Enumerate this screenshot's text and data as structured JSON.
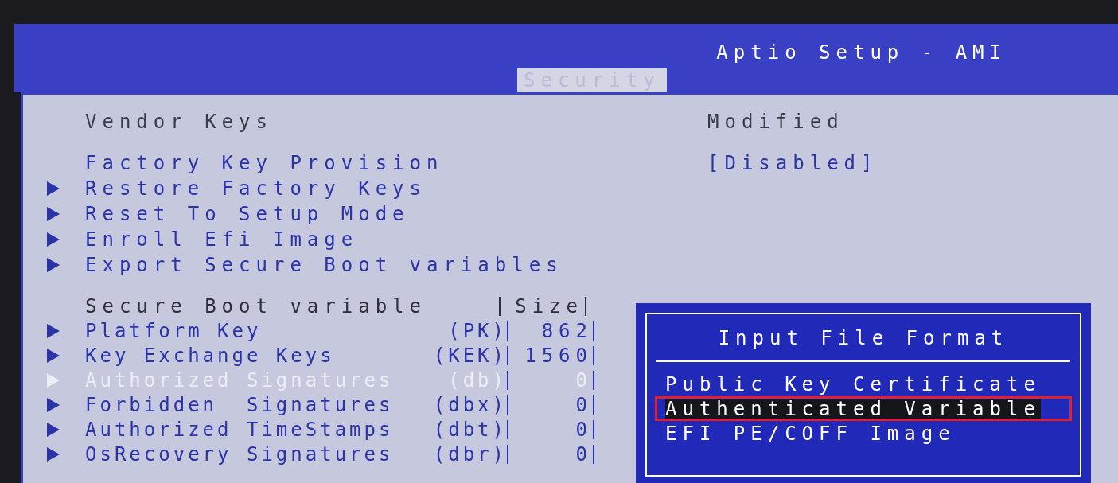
{
  "header": {
    "title": "Aptio Setup - AMI",
    "tabs": [
      {
        "label": "Security",
        "selected": true
      }
    ]
  },
  "sections": [
    {
      "items": [
        {
          "kind": "info",
          "label": "Vendor Keys",
          "value": "Modified"
        }
      ]
    },
    {
      "items": [
        {
          "kind": "option",
          "label": "Factory Key Provision",
          "value": "[Disabled]"
        },
        {
          "kind": "submenu",
          "label": "Restore Factory Keys"
        },
        {
          "kind": "submenu",
          "label": "Reset To Setup Mode"
        },
        {
          "kind": "submenu",
          "label": "Enroll Efi Image"
        },
        {
          "kind": "submenu",
          "label": "Export Secure Boot variables"
        }
      ]
    }
  ],
  "variables_table": {
    "columns": [
      "Secure Boot variable",
      "Size"
    ],
    "rows": [
      {
        "name": "Platform Key",
        "code": "(PK)",
        "size": "862",
        "disabled": false
      },
      {
        "name": "Key Exchange Keys",
        "code": "(KEK)",
        "size": "1560",
        "disabled": false
      },
      {
        "name": "Authorized Signatures",
        "code": "(db)",
        "size": "0",
        "disabled": true
      },
      {
        "name": "Forbidden  Signatures",
        "code": "(dbx)",
        "size": "0",
        "disabled": false
      },
      {
        "name": "Authorized TimeStamps",
        "code": "(dbt)",
        "size": "0",
        "disabled": false
      },
      {
        "name": "OsRecovery Signatures",
        "code": "(dbr)",
        "size": "0",
        "disabled": false
      }
    ]
  },
  "popup": {
    "title": "Input File Format",
    "options": [
      {
        "label": "Public Key Certificate",
        "selected": false,
        "marked": false
      },
      {
        "label": "Authenticated Variable",
        "selected": true,
        "marked": true
      },
      {
        "label": "EFI PE/COFF Image",
        "selected": false,
        "marked": false
      }
    ]
  }
}
